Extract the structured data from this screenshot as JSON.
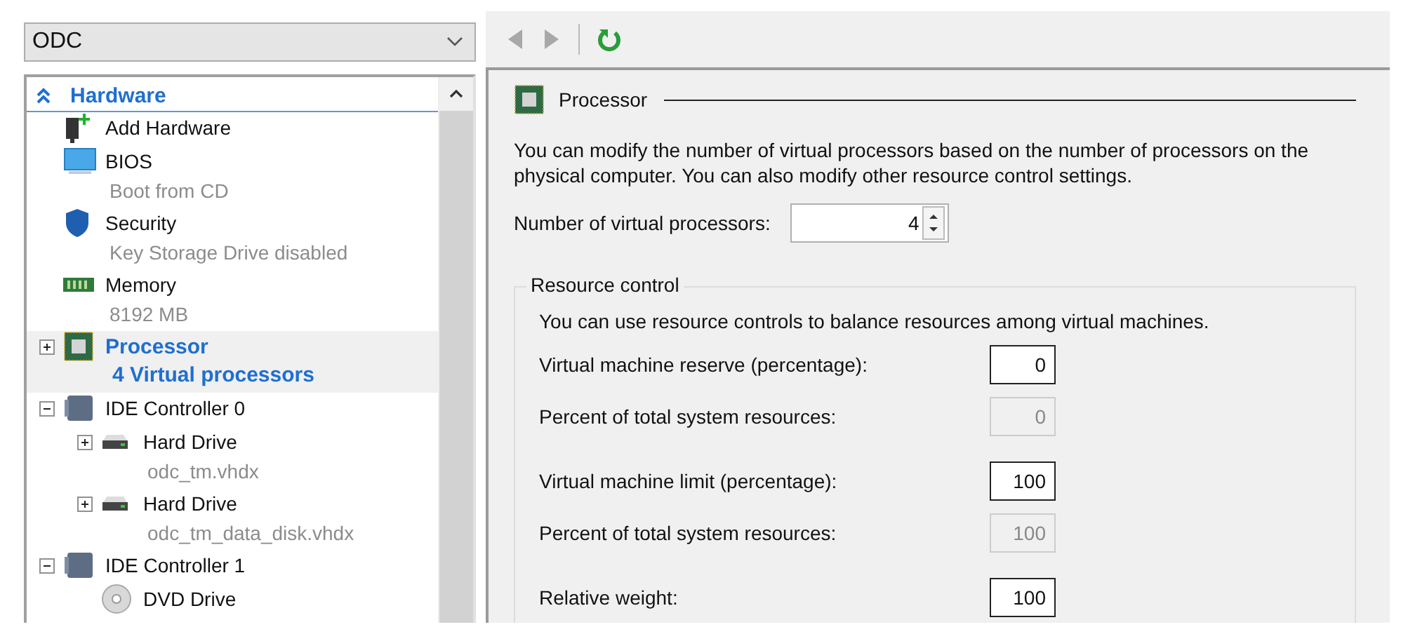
{
  "vm_selector": {
    "value": "ODC"
  },
  "hardware_tree": {
    "section": {
      "title": "Hardware",
      "expanded": true
    },
    "items": [
      {
        "label": "Add Hardware",
        "kind": "add-hardware",
        "selected": false
      },
      {
        "label": "BIOS",
        "detail": "Boot from CD",
        "kind": "firmware",
        "selected": false
      },
      {
        "label": "Security",
        "detail": "Key Storage Drive disabled",
        "kind": "security",
        "selected": false
      },
      {
        "label": "Memory",
        "detail": "8192 MB",
        "kind": "memory",
        "selected": false
      },
      {
        "label": "Processor",
        "detail": "4 Virtual processors",
        "kind": "processor",
        "expanded": false,
        "selected": true
      },
      {
        "label": "IDE Controller 0",
        "kind": "controller",
        "expanded": true,
        "selected": false,
        "children": [
          {
            "label": "Hard Drive",
            "detail": "odc_tm.vhdx",
            "kind": "disk",
            "expanded": false,
            "selected": false
          },
          {
            "label": "Hard Drive",
            "detail": "odc_tm_data_disk.vhdx",
            "kind": "disk",
            "expanded": false,
            "selected": false
          }
        ]
      },
      {
        "label": "IDE Controller 1",
        "kind": "controller",
        "expanded": true,
        "selected": false,
        "children": [
          {
            "label": "DVD Drive",
            "kind": "dvd",
            "selected": false
          }
        ]
      }
    ]
  },
  "processor_panel": {
    "title": "Processor",
    "description": "You can modify the number of virtual processors based on the number of processors on the physical computer. You can also modify other resource control settings.",
    "processor_count": {
      "label": "Number of virtual processors:",
      "value": "4"
    },
    "resource_control": {
      "title": "Resource control",
      "description": "You can use resource controls to balance resources among virtual machines.",
      "fields": [
        {
          "label": "Virtual machine reserve (percentage):",
          "value": "0",
          "disabled": false
        },
        {
          "label": "Percent of total system resources:",
          "value": "0",
          "disabled": true
        },
        {
          "label": "Virtual machine limit (percentage):",
          "value": "100",
          "disabled": false
        },
        {
          "label": "Percent of total system resources:",
          "value": "100",
          "disabled": true
        },
        {
          "label": "Relative weight:",
          "value": "100",
          "disabled": false
        }
      ]
    }
  }
}
